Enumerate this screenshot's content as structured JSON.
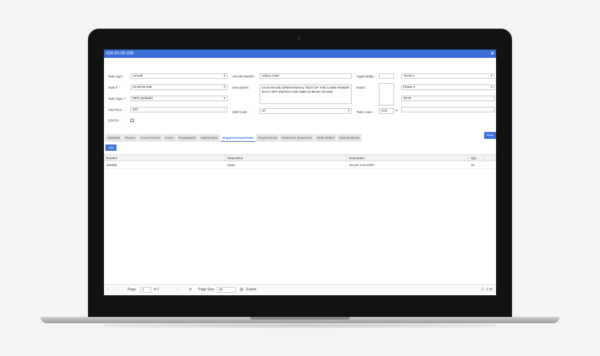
{
  "window": {
    "title": "#24-20-00-206"
  },
  "form": {
    "task_appl_label": "Task Appl :",
    "task_appl_value": "Aircraft",
    "task_no_label": "Task # :",
    "task_no_value": "24-20-00-206",
    "task_type_label": "Task Type :",
    "task_type_value": "MPD (Default)",
    "flat_price_label": "Flat Price :",
    "flat_price_value": "100",
    "cdccl_label": "CDCCL :",
    "aircraft_models_label": "Aircraft Models :",
    "aircraft_models_value": "Airbus A320",
    "description_label": "Description :",
    "description_value": "24-20-00-206 OPERATIONAL TEST OF THE CABIN POWER SHUT OFF SWITCH IAW AMM 24-68-00-710-802",
    "skill_code_label": "Skill Code :",
    "skill_code_value": "AF",
    "applicability_label": "Applicability :",
    "notes_label": "Notes :",
    "task_code_label": "Task Code :",
    "task_code_value": "VCK",
    "team_value": "TEAM 1",
    "phase_value": "Phase 3",
    "time_value": "00:00",
    "at_label": "at"
  },
  "toolbar": {
    "save_label": "Save",
    "add_label": "Add"
  },
  "tabs": [
    {
      "label": "Subtasks"
    },
    {
      "label": "Phases"
    },
    {
      "label": "Access Panels"
    },
    {
      "label": "Zones"
    },
    {
      "label": "Preparations"
    },
    {
      "label": "Attachments"
    },
    {
      "label": "Required Parts/Tools"
    },
    {
      "label": "Requirements"
    },
    {
      "label": "Reference documents"
    },
    {
      "label": "Work Orders"
    },
    {
      "label": "Task Revisions"
    }
  ],
  "active_tab": "Required Parts/Tools",
  "grid": {
    "columns": [
      "Number",
      "Disposition",
      "Description",
      "Qty."
    ],
    "rows": [
      {
        "number": "109486",
        "disposition": "Issue",
        "description": "VALVE SHUTOFF",
        "qty": "10",
        "menu": "..."
      }
    ]
  },
  "pager": {
    "page_label": "Page",
    "page_value": "1",
    "of_label": "of 1",
    "page_size_label": "Page Size",
    "page_size_value": "25",
    "export_label": "Export",
    "range_label": "1 - 1 of"
  },
  "colors": {
    "accent": "#3d6fd8",
    "bezel": "#121212"
  }
}
